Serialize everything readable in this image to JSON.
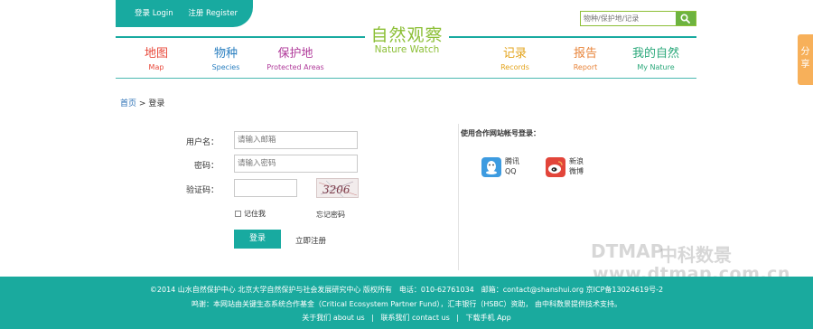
{
  "header": {
    "login_label": "登录 Login",
    "register_label": "注册 Register",
    "logo_cn": "自然观察",
    "logo_en": "Nature Watch",
    "search_placeholder": "物种/保护地/记录",
    "search_icon": "search-icon",
    "brand_color": "#18aaa0",
    "accent_color": "#8cbf36"
  },
  "nav": {
    "left": [
      {
        "cn": "地图",
        "en": "Map",
        "color": "#e8483a"
      },
      {
        "cn": "物种",
        "en": "Species",
        "color": "#2a7fc0"
      },
      {
        "cn": "保护地",
        "en": "Protected Areas",
        "color": "#b03a9a"
      }
    ],
    "right": [
      {
        "cn": "记录",
        "en": "Records",
        "color": "#e3a31a"
      },
      {
        "cn": "报告",
        "en": "Report",
        "color": "#e8843a"
      },
      {
        "cn": "我的自然",
        "en": "My Nature",
        "color": "#2aa87a"
      }
    ]
  },
  "share": {
    "label": "分享"
  },
  "breadcrumb": {
    "home": "首页",
    "sep": ">",
    "current": "登录"
  },
  "form": {
    "username_label": "用户名：",
    "username_placeholder": "请输入邮箱",
    "password_label": "密码：",
    "password_placeholder": "请输入密码",
    "captcha_label": "验证码：",
    "captcha_text": "3206",
    "remember_label": "记住我",
    "forgot_label": "忘记密码",
    "login_button": "登录",
    "register_link": "立即注册"
  },
  "partners": {
    "title": "使用合作网站帐号登录：",
    "items": [
      {
        "name": "腾讯",
        "sub": "QQ",
        "icon": "qq-icon",
        "color": "#3d9be0"
      },
      {
        "name": "新浪",
        "sub": "微博",
        "icon": "weibo-icon",
        "color": "#e2453a"
      }
    ]
  },
  "watermark": {
    "logo": "DTMAP",
    "cn": "中科数景",
    "url": "www.dtmap.com.cn"
  },
  "footer": {
    "line1": "©2014 山水自然保护中心 北京大学自然保护与社会发展研究中心 版权所有　电话：010-62761034　邮箱：contact@shanshui.org 京ICP备13024619号-2",
    "line2": "鸣谢：本网站由关键生态系统合作基金（Critical Ecosystem Partner Fund），汇丰银行（HSBC）资助， 由中科数景提供技术支持。",
    "links": [
      "关于我们 about us",
      "联系我们 contact us",
      "下载手机 App"
    ],
    "link_sep": "|"
  }
}
